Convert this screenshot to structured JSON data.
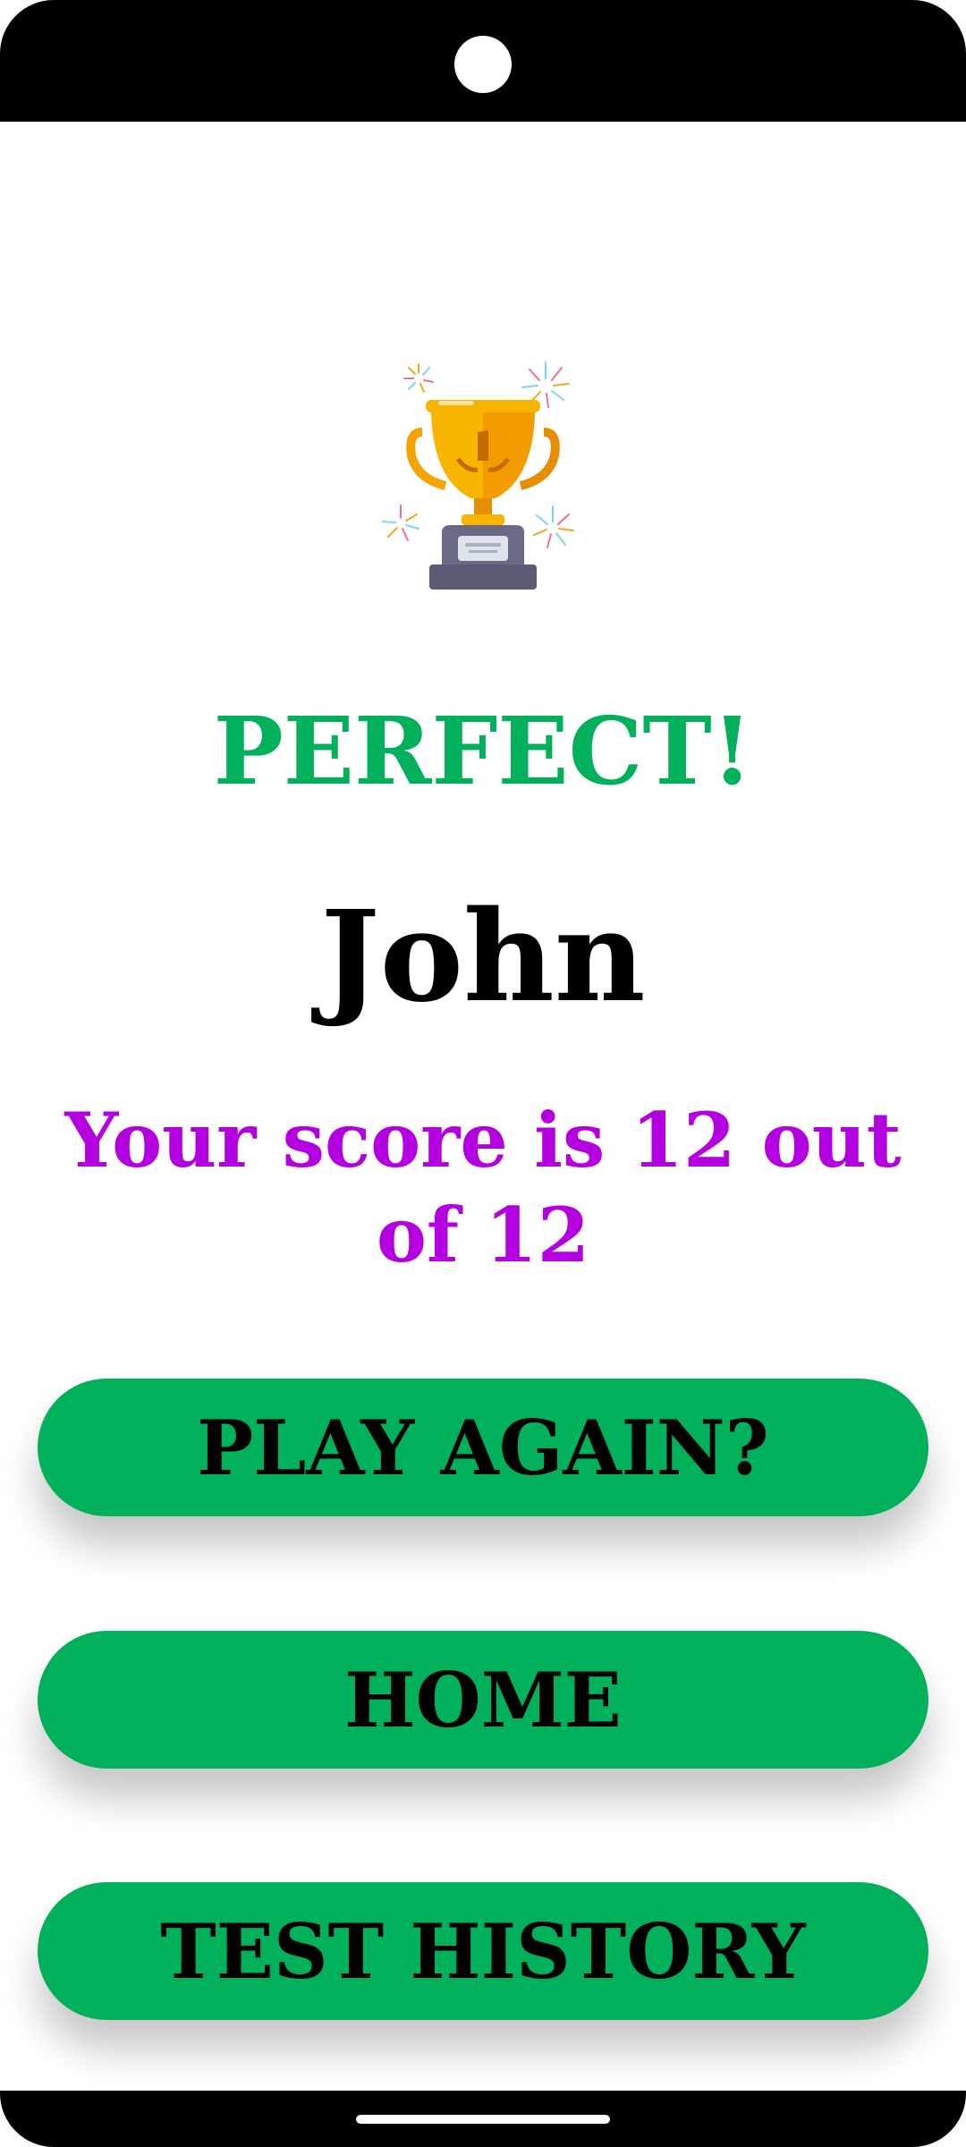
{
  "result": {
    "title": "PERFECT!",
    "player_name": "John",
    "score_text": "Your score is 12 out of 12"
  },
  "buttons": {
    "play_again": "PLAY AGAIN?",
    "home": "HOME",
    "test_history": "TEST HISTORY"
  },
  "icons": {
    "trophy": "trophy-icon",
    "camera": "camera-icon"
  },
  "colors": {
    "accent_green": "#00b05a",
    "score_purple": "#b400e0",
    "text_black": "#000000"
  }
}
